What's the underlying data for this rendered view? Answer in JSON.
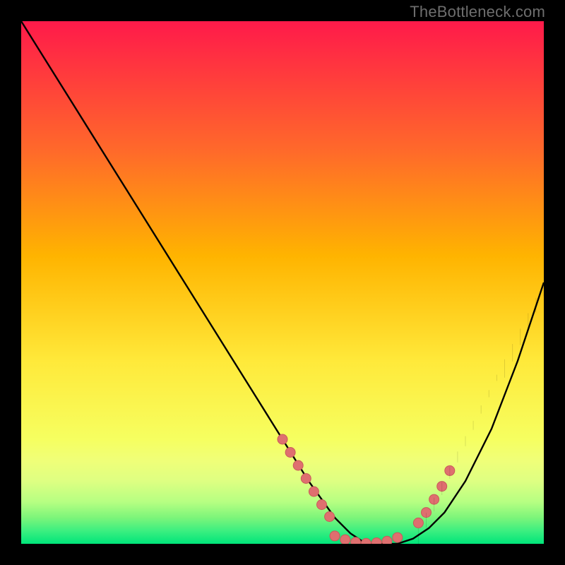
{
  "watermark": {
    "text": "TheBottleneck.com"
  },
  "colors": {
    "bg_black": "#000000",
    "curve": "#000000",
    "dot_fill": "#df6f6f",
    "dot_stroke": "#c85a5a",
    "grad_top": "#ff1a4a",
    "grad_mid1": "#ff9a2a",
    "grad_mid2": "#ffe93a",
    "grad_low1": "#f6ff60",
    "grad_low2": "#d4ff80",
    "grad_bottom": "#00e57a"
  },
  "chart_data": {
    "type": "line",
    "title": "",
    "xlabel": "",
    "ylabel": "",
    "xlim": [
      0,
      100
    ],
    "ylim": [
      0,
      100
    ],
    "curve": {
      "x": [
        0,
        5,
        10,
        15,
        20,
        25,
        30,
        35,
        40,
        45,
        50,
        55,
        60,
        63,
        66,
        69,
        72,
        75,
        78,
        81,
        85,
        90,
        95,
        100
      ],
      "y": [
        100,
        92,
        84,
        76,
        68,
        60,
        52,
        44,
        36,
        28,
        20,
        12,
        5,
        2,
        0,
        0,
        0,
        1,
        3,
        6,
        12,
        22,
        35,
        50
      ]
    },
    "dots_left": {
      "x": [
        50,
        51.5,
        53,
        54.5,
        56,
        57.5,
        59
      ],
      "y": [
        20,
        17.5,
        15,
        12.5,
        10,
        7.5,
        5.2
      ]
    },
    "dots_bottom": {
      "x": [
        60,
        62,
        64,
        66,
        68,
        70,
        72
      ],
      "y": [
        1.5,
        0.8,
        0.3,
        0.1,
        0.2,
        0.5,
        1.2
      ]
    },
    "dots_right": {
      "x": [
        76,
        77.5,
        79,
        80.5,
        82
      ],
      "y": [
        4,
        6,
        8.5,
        11,
        14
      ]
    },
    "gradient_stops": [
      {
        "offset": 0.0,
        "color": "#ff1a4a"
      },
      {
        "offset": 0.25,
        "color": "#ff6a2a"
      },
      {
        "offset": 0.45,
        "color": "#ffb400"
      },
      {
        "offset": 0.65,
        "color": "#ffe93a"
      },
      {
        "offset": 0.8,
        "color": "#f6ff60"
      },
      {
        "offset": 0.84,
        "color": "#f0ff78"
      },
      {
        "offset": 0.88,
        "color": "#deff82"
      },
      {
        "offset": 0.92,
        "color": "#b6ff82"
      },
      {
        "offset": 0.95,
        "color": "#7cf57a"
      },
      {
        "offset": 0.975,
        "color": "#3cef80"
      },
      {
        "offset": 1.0,
        "color": "#00e57a"
      }
    ]
  }
}
